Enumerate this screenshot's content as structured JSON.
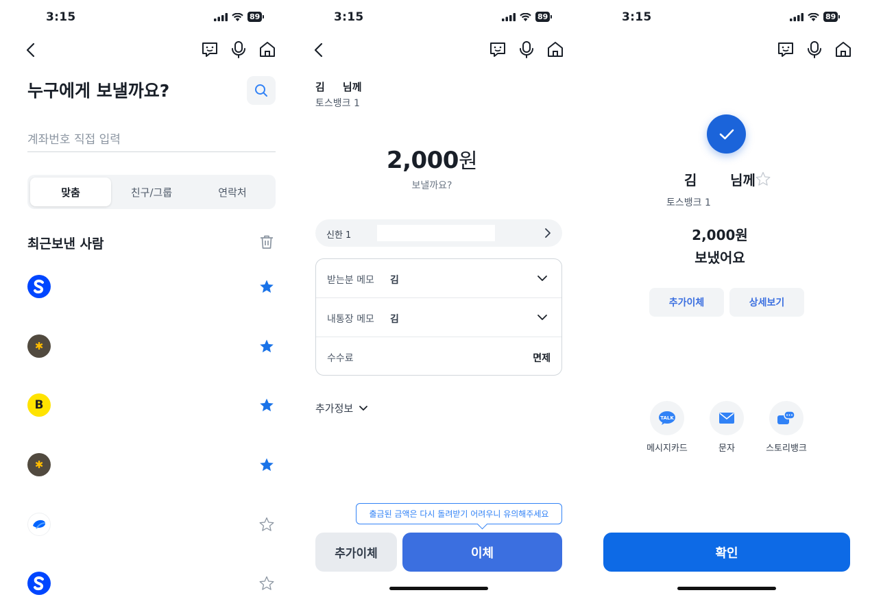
{
  "colors": {
    "accent": "#3182f6",
    "primary_button": "#3b6fe0",
    "confirm_button": "#0d6ae6",
    "star": "#1a73e8"
  },
  "status": {
    "time": "3:15",
    "battery": "89"
  },
  "screen1": {
    "title": "누구에게 보낼까요?",
    "account_placeholder": "계좌번호 직접 입력",
    "tabs": [
      "맞춤",
      "친구/그룹",
      "연락처"
    ],
    "recent_title": "최근보낸 사람",
    "recent": [
      {
        "bank_icon": "shinhan-logo",
        "favorite": true
      },
      {
        "bank_icon": "kb-logo",
        "favorite": true
      },
      {
        "bank_icon": "kakaobank-logo",
        "favorite": true
      },
      {
        "bank_icon": "kb-logo",
        "favorite": true
      },
      {
        "bank_icon": "toss-logo",
        "favorite": false
      },
      {
        "bank_icon": "shinhan-logo",
        "favorite": false
      }
    ]
  },
  "screen2": {
    "recipient_name": "김     님께",
    "recipient_bank": "토스뱅크 1",
    "amount": "2,000",
    "currency": "원",
    "question": "보낼까요?",
    "from_account": "신한 1",
    "recipient_memo_label": "받는분 메모",
    "recipient_memo_value": "김",
    "my_memo_label": "내통장 메모",
    "my_memo_value": "김",
    "fee_label": "수수료",
    "fee_value": "면제",
    "extra_info": "추가정보",
    "tooltip": "출금된 금액은 다시 돌려받기 어려우니 유의해주세요",
    "add_transfer": "추가이체",
    "transfer": "이체"
  },
  "screen3": {
    "recipient_name": "김       님께",
    "recipient_bank": "토스뱅크 1",
    "amount_text": "2,000원",
    "done_text": "보냈어요",
    "add_transfer": "추가이체",
    "details": "상세보기",
    "share": [
      "메시지카드",
      "문자",
      "스토리뱅크"
    ],
    "confirm": "확인"
  }
}
